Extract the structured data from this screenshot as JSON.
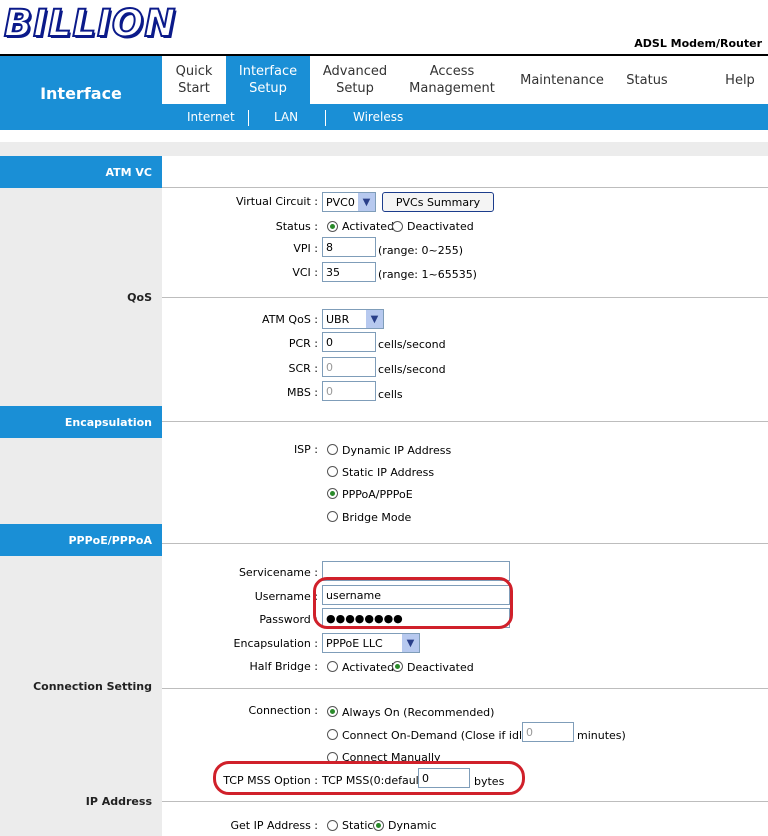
{
  "brand": {
    "logo_text": "BILLION",
    "product": "ADSL Modem/Router"
  },
  "page_title": "Interface",
  "nav": [
    {
      "label": "Quick\nStart"
    },
    {
      "label": "Interface\nSetup"
    },
    {
      "label": "Advanced\nSetup"
    },
    {
      "label": "Access\nManagement"
    },
    {
      "label": "Maintenance"
    },
    {
      "label": "Status"
    },
    {
      "label": "Help"
    }
  ],
  "subnav": [
    {
      "label": "Internet"
    },
    {
      "label": "LAN"
    },
    {
      "label": "Wireless"
    }
  ],
  "sections": {
    "atm_vc": "ATM VC",
    "qos": "QoS",
    "encapsulation": "Encapsulation",
    "pppoe": "PPPoE/PPPoA",
    "connection_setting": "Connection Setting",
    "ip_address": "IP Address"
  },
  "atm": {
    "vc_label": "Virtual Circuit :",
    "vc_value": "PVC0",
    "summary_button": "PVCs Summary",
    "status_label": "Status :",
    "status_activated": "Activated",
    "status_deactivated": "Deactivated",
    "vpi_label": "VPI :",
    "vpi_value": "8",
    "vpi_range": "(range: 0~255)",
    "vci_label": "VCI :",
    "vci_value": "35",
    "vci_range": "(range: 1~65535)"
  },
  "qos": {
    "atm_qos_label": "ATM QoS :",
    "atm_qos_value": "UBR",
    "pcr_label": "PCR :",
    "pcr_value": "0",
    "pcr_unit": "cells/second",
    "scr_label": "SCR :",
    "scr_value": "0",
    "scr_unit": "cells/second",
    "mbs_label": "MBS :",
    "mbs_value": "0",
    "mbs_unit": "cells"
  },
  "isp": {
    "label": "ISP :",
    "options": [
      "Dynamic IP Address",
      "Static IP Address",
      "PPPoA/PPPoE",
      "Bridge Mode"
    ],
    "selected": "PPPoA/PPPoE"
  },
  "pppoe": {
    "servicename_label": "Servicename :",
    "servicename_value": "",
    "username_label": "Username :",
    "username_value": "username",
    "password_label": "Password :",
    "password_value": "●●●●●●●●",
    "encap_label": "Encapsulation :",
    "encap_value": "PPPoE LLC",
    "half_bridge_label": "Half Bridge :",
    "hb_activated": "Activated",
    "hb_deactivated": "Deactivated"
  },
  "connection": {
    "label": "Connection :",
    "always_on": "Always On (Recommended)",
    "on_demand": "Connect On-Demand (Close if idle for",
    "on_demand_value": "0",
    "on_demand_unit": "minutes)",
    "manually": "Connect Manually",
    "tcp_mss_label": "TCP MSS Option :",
    "tcp_mss_text": "TCP MSS(0:default)",
    "tcp_mss_value": "0",
    "tcp_mss_unit": "bytes"
  },
  "ip": {
    "get_ip_label": "Get IP Address :",
    "static": "Static",
    "dynamic": "Dynamic"
  },
  "colors": {
    "accent": "#1a8fd6",
    "highlight": "#d0202a",
    "panel": "#ececec"
  }
}
